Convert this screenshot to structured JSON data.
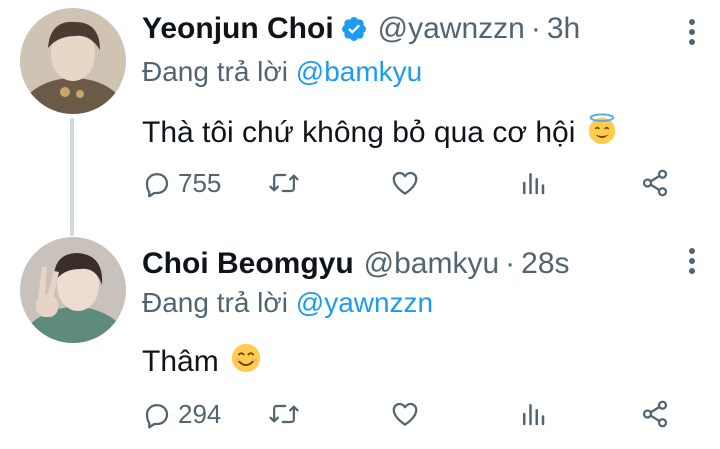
{
  "tweets": [
    {
      "name": "Yeonjun Choi",
      "handle": "@yawnzzn",
      "separator": "·",
      "time": "3h",
      "verified": true,
      "replying_prefix": "Đang trả lời",
      "replying_to": "@bamkyu",
      "text": "Thà tôi chứ không bỏ qua cơ hội",
      "emoji": "smiling-face-with-halo",
      "reply_count": "755",
      "avatar_tone": "#8b7a6a"
    },
    {
      "name": "Choi Beomgyu",
      "handle": "@bamkyu",
      "separator": "·",
      "time": "28s",
      "verified": false,
      "replying_prefix": "Đang trả lời",
      "replying_to": "@yawnzzn",
      "text": "Thâm",
      "emoji": "smiling-face-with-smiling-eyes",
      "reply_count": "294",
      "avatar_tone": "#5f8a7e"
    }
  ],
  "colors": {
    "text": "#0f1419",
    "muted": "#536471",
    "accent": "#1d9bf0",
    "thread_line": "#cfd9de"
  }
}
